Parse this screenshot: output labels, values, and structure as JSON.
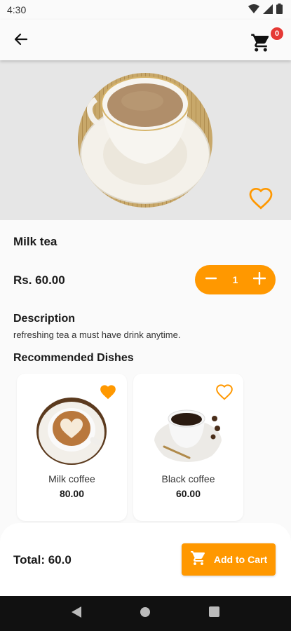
{
  "status_bar": {
    "time": "4:30"
  },
  "header": {
    "cart_count": "0"
  },
  "product": {
    "name": "Milk tea",
    "price": "Rs. 60.00",
    "quantity": "1",
    "description_heading": "Description",
    "description": "refreshing tea a must have drink anytime.",
    "favorite": false
  },
  "recommended": {
    "heading": "Recommended Dishes",
    "items": [
      {
        "name": "Milk coffee",
        "price": "80.00",
        "favorite": true
      },
      {
        "name": "Black coffee",
        "price": "60.00",
        "favorite": false
      }
    ]
  },
  "footer": {
    "total": "Total: 60.0",
    "add_to_cart_label": "Add to Cart"
  },
  "colors": {
    "accent": "#ff9800",
    "badge": "#e53935",
    "nav_bar": "#111111"
  }
}
